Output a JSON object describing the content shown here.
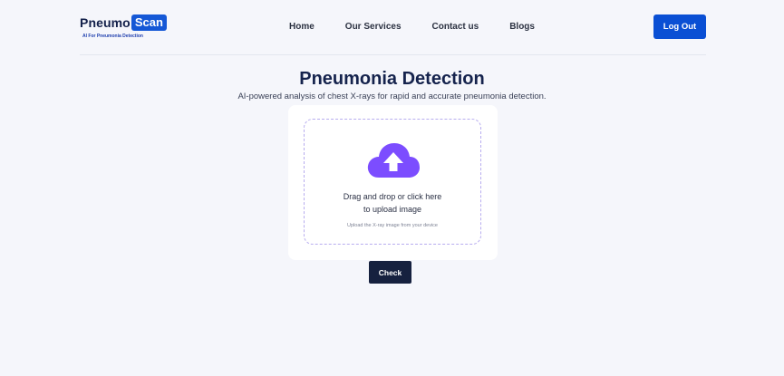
{
  "brand": {
    "name_part1": "Pneumo",
    "name_part2": "Scan",
    "tagline": "AI For Pneumonia Detection",
    "accent_color": "#1558d6"
  },
  "nav": {
    "items": [
      {
        "label": "Home"
      },
      {
        "label": "Our Services"
      },
      {
        "label": "Contact us"
      },
      {
        "label": "Blogs"
      }
    ],
    "logout_label": "Log Out"
  },
  "hero": {
    "title": "Pneumonia Detection",
    "subtitle": "AI-powered analysis of chest X-rays for rapid and accurate pneumonia detection."
  },
  "upload": {
    "icon": "cloud-upload-icon",
    "icon_color": "#7c4dff",
    "line1": "Drag and drop or click here",
    "line2": "to upload image",
    "hint": "Upload the X-ray image from your device"
  },
  "actions": {
    "check_label": "Check"
  }
}
